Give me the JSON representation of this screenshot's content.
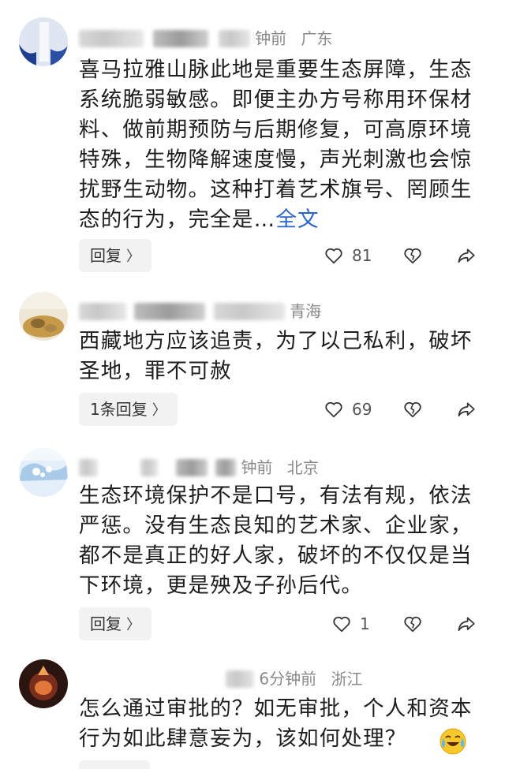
{
  "comments": [
    {
      "meta_tail": "钟前",
      "location": "广东",
      "text": "喜马拉雅山脉此地是重要生态屏障，生态系统脆弱敏感。即便主办方号称用环保材料、做前期预防与后期修复，可高原环境特殊，生物降解速度慢，声光刺激也会惊扰野生动物。这种打着艺术旗号、罔顾生态的行为，完全是…",
      "more": "全文",
      "reply_label": "回复",
      "likes": "81",
      "avatar_icon": "user-avatar-blue",
      "colors": {
        "avatar_main": "#1d3f8f",
        "avatar_light": "#cfd8ea"
      }
    },
    {
      "meta_tail": "",
      "location": "青海",
      "text": "西藏地方应该追责，为了以己私利，破坏圣地，罪不可赦",
      "more": "",
      "reply_label": "1条回复",
      "likes": "69",
      "avatar_icon": "user-avatar-sand",
      "colors": {
        "avatar_main": "#c9a45b",
        "avatar_light": "#e8ddc6"
      }
    },
    {
      "meta_tail": "钟前",
      "location": "北京",
      "text": "生态环境保护不是口号，有法有规，依法严惩。没有生态良知的艺术家、企业家，都不是真正的好人家，破坏的不仅仅是当下环境，更是殃及子孙后代。",
      "more": "",
      "reply_label": "回复",
      "likes": "1",
      "avatar_icon": "user-avatar-snow",
      "colors": {
        "avatar_main": "#9fc4e6",
        "avatar_light": "#e4eff9"
      }
    },
    {
      "meta_tail": "6分钟前",
      "location": "浙江",
      "text": "怎么通过审批的？如无审批，个人和资本行为如此肆意妄为，该如何处理？",
      "more": "",
      "reply_label": "",
      "likes": "",
      "avatar_icon": "user-avatar-dark",
      "colors": {
        "avatar_main": "#7a2d1b",
        "avatar_light": "#e2773c"
      }
    }
  ],
  "icons": {
    "like": "heart-outline-icon",
    "dislike": "broken-heart-icon",
    "share": "share-arrow-icon",
    "reply_chevron": "chevron-right-icon",
    "emoji": "crying-laughing-emoji-icon"
  },
  "reply_chevron_glyph": "〉"
}
